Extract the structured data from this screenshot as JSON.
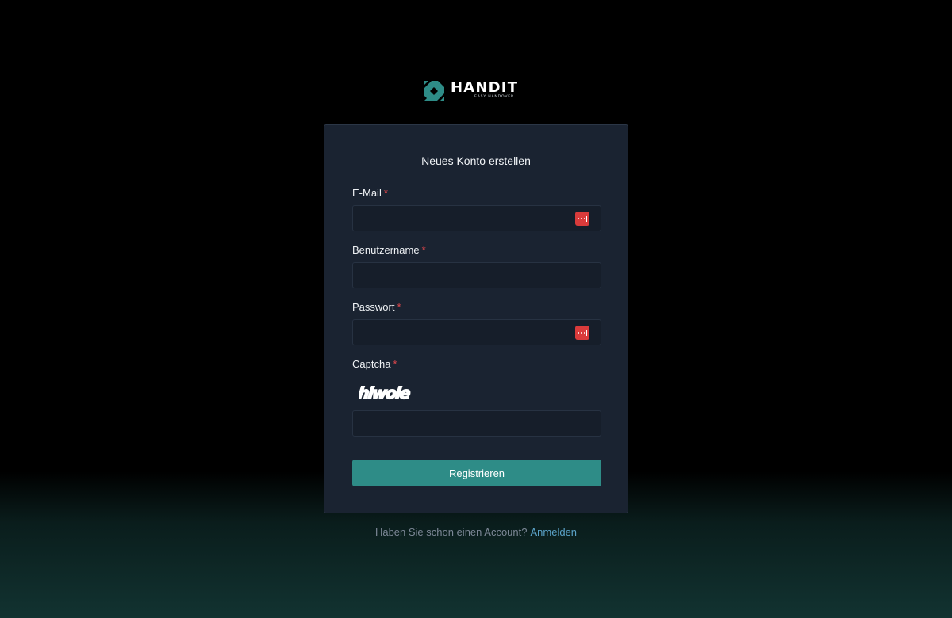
{
  "brand": {
    "name": "HANDIT",
    "tagline": "EASY HANDOVER",
    "logo_color": "#2e8c87"
  },
  "form": {
    "title": "Neues Konto erstellen",
    "required_marker": "*",
    "fields": {
      "email": {
        "label": "E-Mail",
        "value": "",
        "placeholder": ""
      },
      "username": {
        "label": "Benutzername",
        "value": "",
        "placeholder": ""
      },
      "password": {
        "label": "Passwort",
        "value": "",
        "placeholder": ""
      },
      "captcha": {
        "label": "Captcha",
        "image_text": "hiwole",
        "value": "",
        "placeholder": ""
      }
    },
    "password_manager_icon": "password-manager-icon",
    "submit_label": "Registrieren"
  },
  "footer": {
    "prompt": "Haben Sie schon einen Account?",
    "link_label": "Anmelden"
  },
  "colors": {
    "accent": "#2e8c87",
    "required": "#e5484d",
    "link": "#5ba3c9",
    "card_bg": "#1a2331"
  }
}
